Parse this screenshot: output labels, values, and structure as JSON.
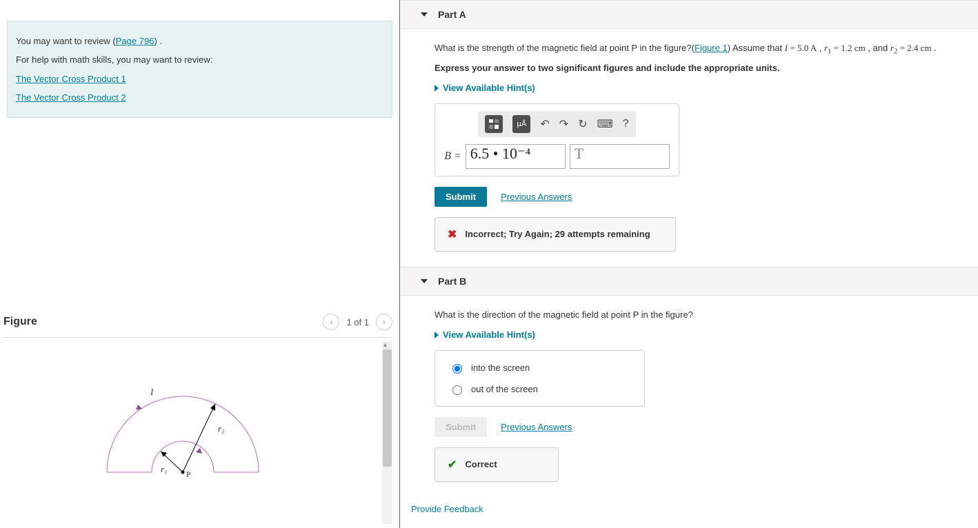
{
  "review": {
    "line1_prefix": "You may want to review (",
    "page_link": "Page 796",
    "line1_suffix": ") .",
    "line2": "For help with math skills, you may want to review:",
    "link1": "The Vector Cross Product 1",
    "link2": "The Vector Cross Product 2"
  },
  "figure": {
    "title": "Figure",
    "counter": "1 of 1",
    "labels": {
      "I": "I",
      "r1": "r₁",
      "r2": "r₂",
      "P": "P"
    }
  },
  "partA": {
    "title": "Part A",
    "question_prefix": "What is the strength of the magnetic field at point P in the figure?(",
    "figure_link": "Figure 1",
    "question_mid": ") Assume that ",
    "I_eq": "I = 5.0 A",
    "sep": " , ",
    "r1_eq": "r₁ = 1.2 cm",
    "and": " , and ",
    "r2_eq": "r₂ = 2.4 cm",
    "question_end": " .",
    "instruction": "Express your answer to two significant figures and include the appropriate units.",
    "hints": "View Available Hint(s)",
    "tool_units": "µÅ",
    "eq_label": "B = ",
    "value": "6.5 • 10⁻⁴",
    "unit": "T",
    "submit": "Submit",
    "previous": "Previous Answers",
    "feedback": "Incorrect; Try Again; 29 attempts remaining"
  },
  "partB": {
    "title": "Part B",
    "question": "What is the direction of the magnetic field at point P in the figure?",
    "hints": "View Available Hint(s)",
    "opt1": "into the screen",
    "opt2": "out of the screen",
    "submit": "Submit",
    "previous": "Previous Answers",
    "feedback": "Correct"
  },
  "footer": {
    "provide_feedback": "Provide Feedback"
  }
}
